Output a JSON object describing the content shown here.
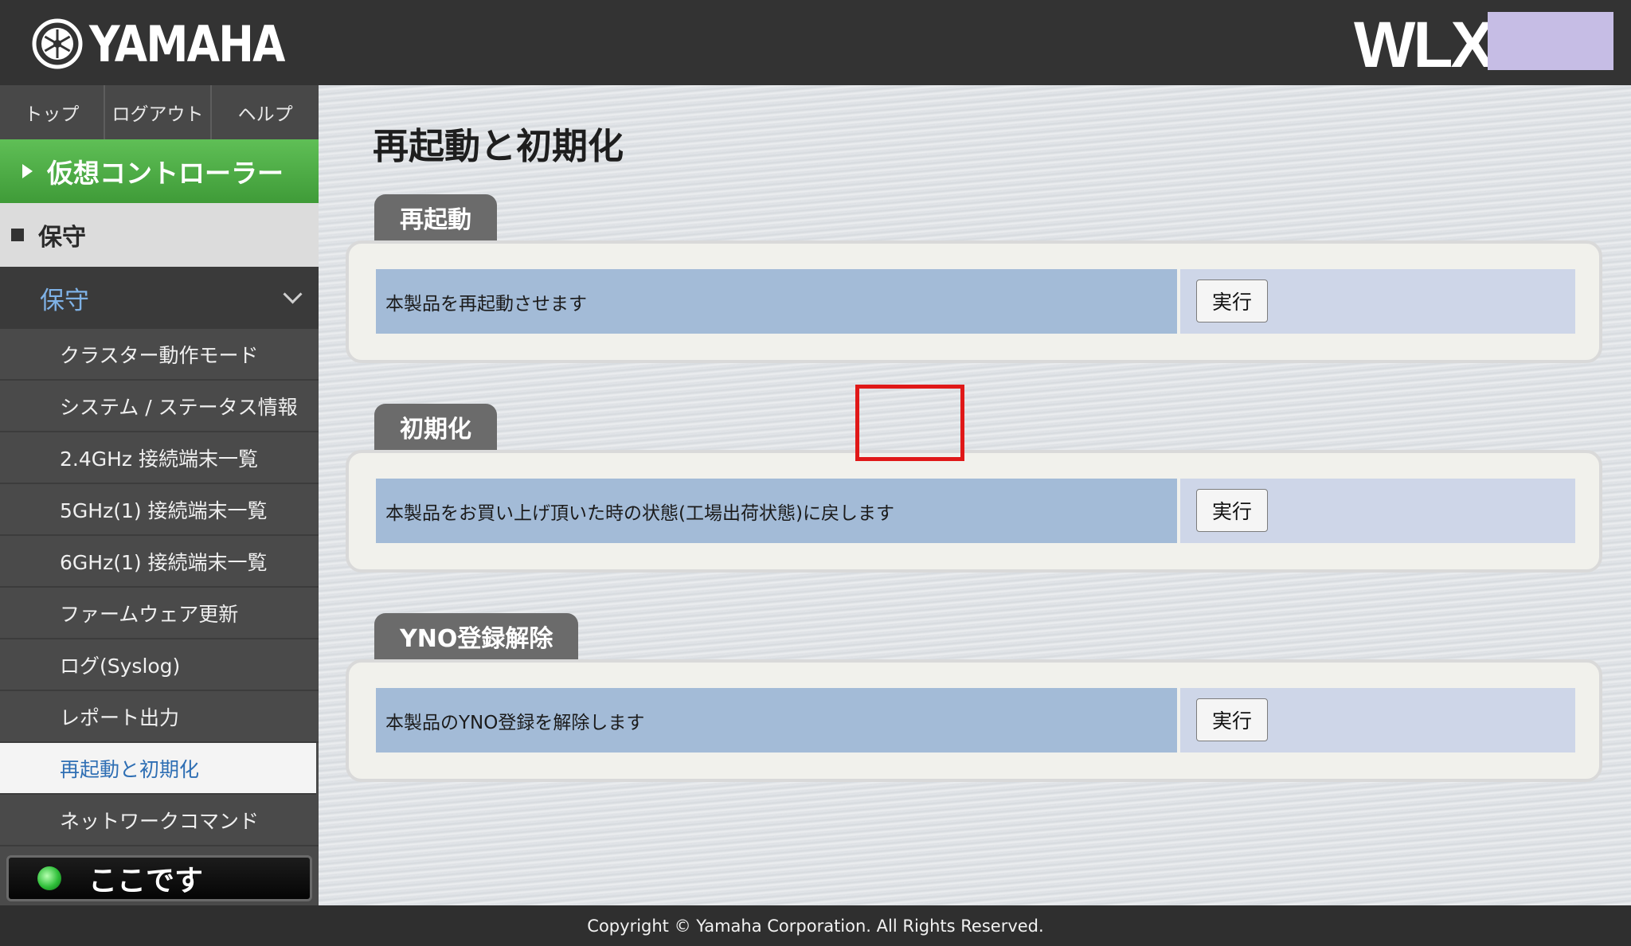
{
  "header": {
    "brand": "YAMAHA",
    "model": "WLX"
  },
  "sidebar": {
    "top_nav": [
      {
        "label": "トップ"
      },
      {
        "label": "ログアウト"
      },
      {
        "label": "ヘルプ"
      }
    ],
    "virtual_controller": "仮想コントローラー",
    "section": "保守",
    "submenu_header": "保守",
    "items": [
      {
        "label": "クラスター動作モード"
      },
      {
        "label": "システム / ステータス情報"
      },
      {
        "label": "2.4GHz 接続端末一覧"
      },
      {
        "label": "5GHz(1) 接続端末一覧"
      },
      {
        "label": "6GHz(1) 接続端末一覧"
      },
      {
        "label": "ファームウェア更新"
      },
      {
        "label": "ログ(Syslog)"
      },
      {
        "label": "レポート出力"
      },
      {
        "label": "再起動と初期化",
        "active": true
      },
      {
        "label": "ネットワークコマンド"
      }
    ],
    "here_button": "ここです"
  },
  "main": {
    "title": "再起動と初期化",
    "sections": [
      {
        "tab": "再起動",
        "description": "本製品を再起動させます",
        "button": "実行"
      },
      {
        "tab": "初期化",
        "description": "本製品をお買い上げ頂いた時の状態(工場出荷状態)に戻します",
        "button": "実行"
      },
      {
        "tab": "YNO登録解除",
        "description": "本製品のYNO登録を解除します",
        "button": "実行"
      }
    ]
  },
  "footer": {
    "copyright": "Copyright © Yamaha Corporation. All Rights Reserved."
  },
  "colors": {
    "header_bg": "#333333",
    "green_button": "#4aa842",
    "active_menu_text": "#2f6fb4",
    "desc_cell": "#a3bbd7",
    "highlight": "#e01818"
  }
}
